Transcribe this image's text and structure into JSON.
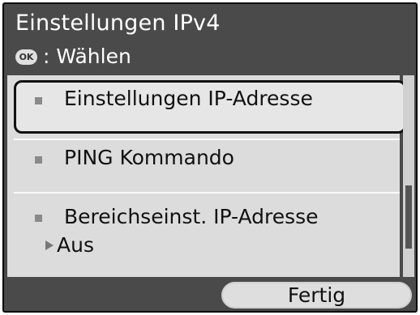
{
  "header": {
    "title": "Einstellungen IPv4",
    "hint_icon": "OK",
    "hint_text": ": Wählen"
  },
  "menu": {
    "items": [
      {
        "label": "Einstellungen IP-Adresse",
        "selected": true
      },
      {
        "label": "PING Kommando"
      },
      {
        "label": "Bereichseinst. IP-Adresse",
        "value": "Aus"
      }
    ]
  },
  "footer": {
    "done_label": "Fertig"
  },
  "colors": {
    "background": "#4a4a4a",
    "list_background": "#dcdcdc",
    "selection_border": "#111111"
  }
}
